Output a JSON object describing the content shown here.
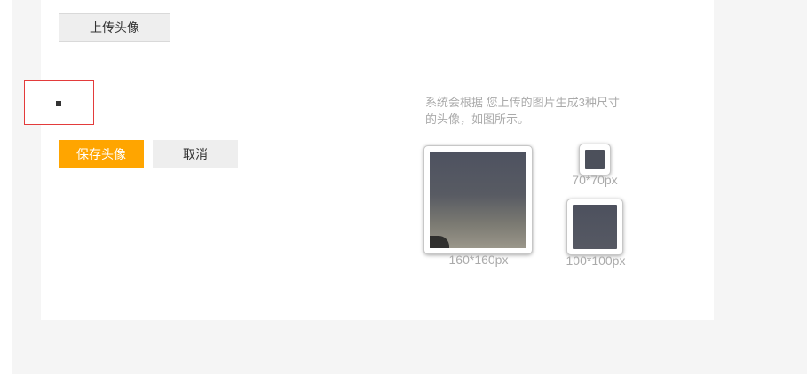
{
  "upload": {
    "label": "上传头像"
  },
  "actions": {
    "save_label": "保存头像",
    "cancel_label": "取消"
  },
  "hint": {
    "text": "系统会根据 您上传的图片生成3种尺寸的头像，如图所示。"
  },
  "previews": [
    {
      "size_label": "160*160px"
    },
    {
      "size_label": "70*70px"
    },
    {
      "size_label": "100*100px"
    }
  ],
  "colors": {
    "accent": "#ffa500",
    "crop_border": "#e33b3b",
    "hint_text": "#aaaaaa",
    "page_bg": "#f5f5f5"
  }
}
